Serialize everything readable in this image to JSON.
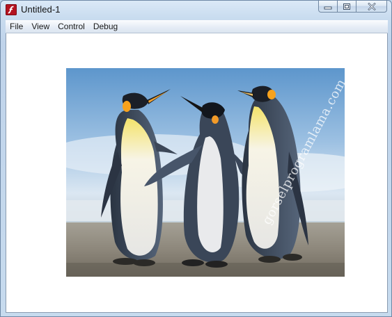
{
  "window": {
    "title": "Untitled-1",
    "app_icon": "flash-player-icon",
    "caption_buttons": [
      "minimize-icon",
      "maximize-icon",
      "close-icon"
    ]
  },
  "menubar": {
    "items": [
      {
        "label": "File"
      },
      {
        "label": "View"
      },
      {
        "label": "Control"
      },
      {
        "label": "Debug"
      }
    ]
  },
  "content": {
    "image_subject": "three emperor penguins on a beach",
    "watermark": "gorselprogramlama.com"
  },
  "colors": {
    "client_bg": "#ffffff",
    "frame": "#c7dbee",
    "icon_red": "#b3121f"
  }
}
